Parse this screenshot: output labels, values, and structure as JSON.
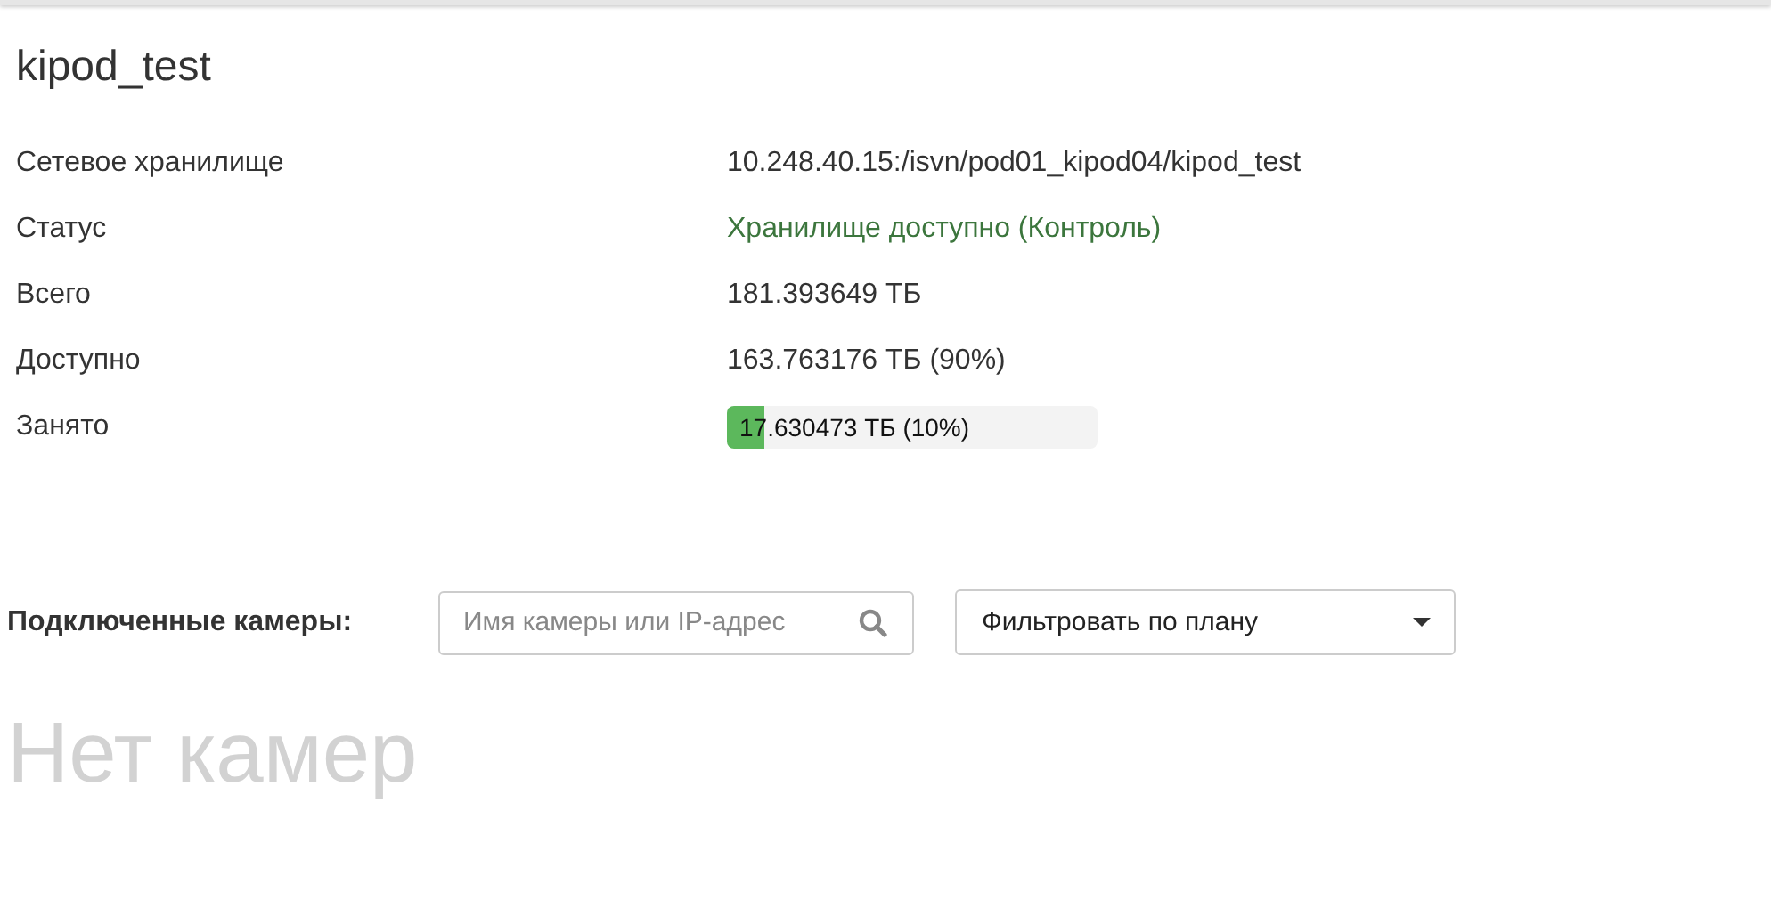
{
  "title": "kipod_test",
  "details": [
    {
      "kind": "text",
      "label": "Сетевое хранилище",
      "value": "10.248.40.15:/isvn/pod01_kipod04/kipod_test"
    },
    {
      "kind": "status",
      "label": "Статус",
      "value": "Хранилище доступно (Контроль)"
    },
    {
      "kind": "text",
      "label": "Всего",
      "value": "181.393649 ТБ"
    },
    {
      "kind": "text",
      "label": "Доступно",
      "value": "163.763176 ТБ (90%)"
    },
    {
      "kind": "progress",
      "label": "Занято",
      "value": "17.630473 ТБ (10%)",
      "level": 0.1
    }
  ],
  "cameras": {
    "label": "Подключенные камеры:",
    "search": {
      "placeholder": "Имя камеры или IP-адрес"
    },
    "filter": "Фильтровать по плану",
    "empty": "Нет камер"
  }
}
